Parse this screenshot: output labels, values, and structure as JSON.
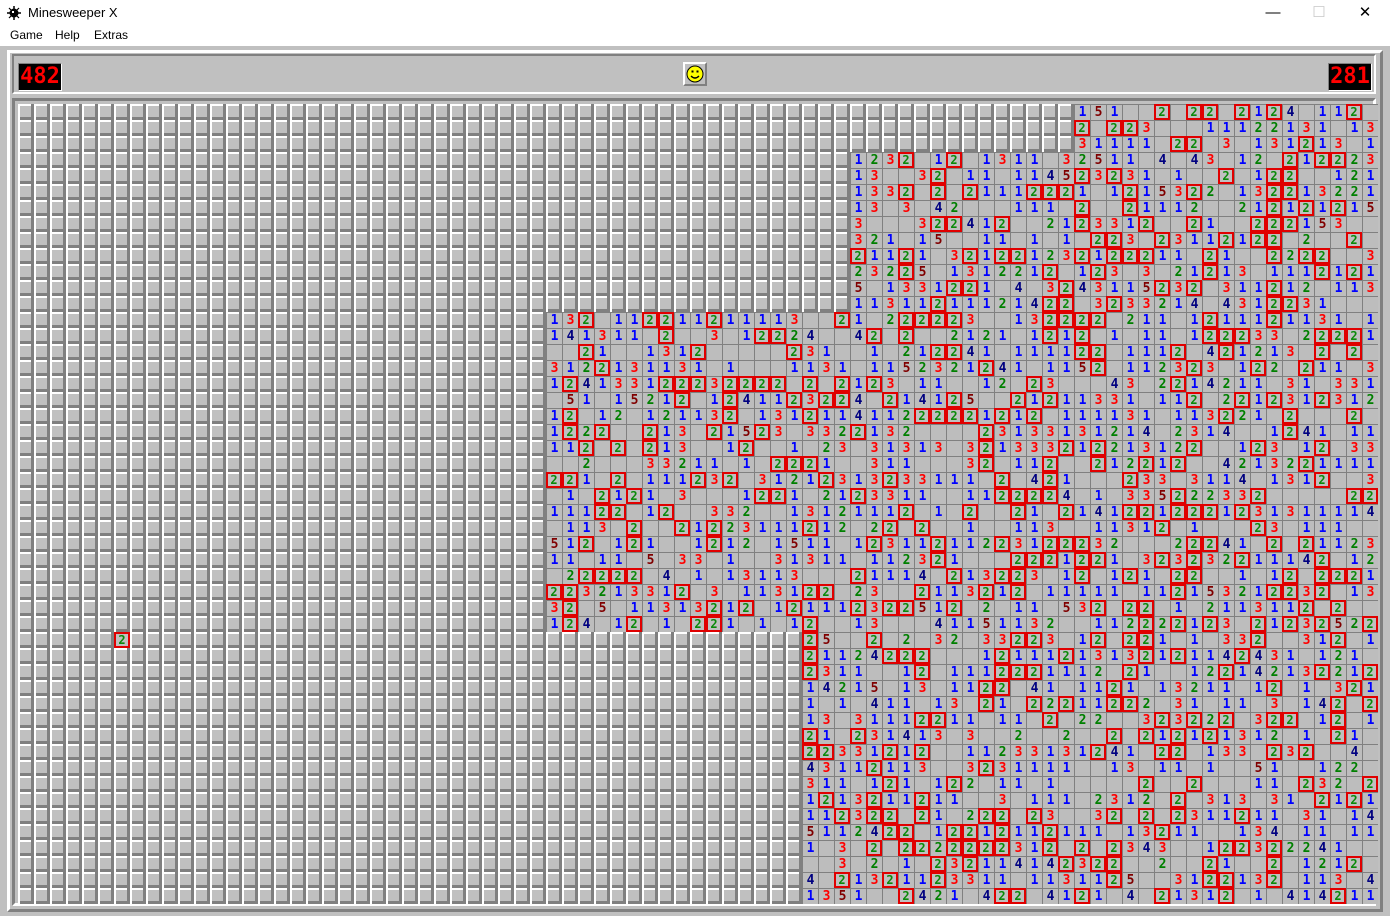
{
  "window": {
    "title": "Minesweeper X",
    "controls": {
      "minimize": "—",
      "maximize": "☐",
      "close": "✕"
    }
  },
  "menu": {
    "items": [
      "Game",
      "Help",
      "Extras"
    ]
  },
  "status": {
    "mines_left": "482",
    "timer": "281",
    "face": "smiley-face-icon"
  },
  "board": {
    "columns": 85,
    "rows": 50,
    "number_colors": {
      "1": "#0000ff",
      "2": "#008000",
      "3": "#ff0000",
      "4": "#000080",
      "5": "#800000",
      "6": "#008080"
    },
    "flag_color": "#e00000"
  }
}
